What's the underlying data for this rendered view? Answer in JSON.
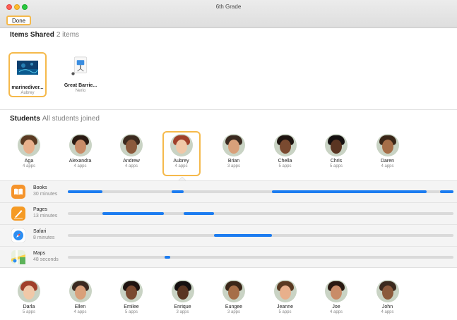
{
  "window": {
    "title": "6th Grade",
    "done_label": "Done"
  },
  "items_shared": {
    "heading": "Items Shared",
    "count": "2 items",
    "items": [
      {
        "title": "marinediver...",
        "owner": "Aubrey",
        "icon": "image-thumbnail-icon"
      },
      {
        "title": "Great Barrie...",
        "owner": "Nerio",
        "icon": "keynote-file-icon"
      }
    ]
  },
  "students": {
    "heading": "Students",
    "status": "All students joined",
    "row1": [
      {
        "name": "Aga",
        "apps": "4 apps"
      },
      {
        "name": "Alexandra",
        "apps": "4 apps"
      },
      {
        "name": "Andrew",
        "apps": "4 apps"
      },
      {
        "name": "Aubrey",
        "apps": "4 apps"
      },
      {
        "name": "Brian",
        "apps": "3 apps"
      },
      {
        "name": "Chella",
        "apps": "5 apps"
      },
      {
        "name": "Chris",
        "apps": "5 apps"
      },
      {
        "name": "Daren",
        "apps": "4 apps"
      }
    ],
    "row2": [
      {
        "name": "Darla",
        "apps": "5 apps"
      },
      {
        "name": "Ellen",
        "apps": "4 apps"
      },
      {
        "name": "Emilee",
        "apps": "5 apps"
      },
      {
        "name": "Enrique",
        "apps": "3 apps"
      },
      {
        "name": "Eungee",
        "apps": "3 apps"
      },
      {
        "name": "Jeanne",
        "apps": "5 apps"
      },
      {
        "name": "Joe",
        "apps": "4 apps"
      },
      {
        "name": "John",
        "apps": "4 apps"
      }
    ]
  },
  "app_usage": [
    {
      "name": "Books",
      "duration": "30 minutes",
      "icon": "books-icon",
      "color": "#f5942c",
      "segments": [
        [
          0.0,
          0.09
        ],
        [
          0.27,
          0.3
        ],
        [
          0.53,
          0.93
        ],
        [
          0.965,
          1.0
        ]
      ]
    },
    {
      "name": "Pages",
      "duration": "13 minutes",
      "icon": "pages-icon",
      "color": "#f59a24",
      "segments": [
        [
          0.09,
          0.25
        ],
        [
          0.3,
          0.38
        ]
      ]
    },
    {
      "name": "Safari",
      "duration": "8 minutes",
      "icon": "safari-icon",
      "color": "#2d8ef2",
      "segments": [
        [
          0.38,
          0.53
        ]
      ]
    },
    {
      "name": "Maps",
      "duration": "48 seconds",
      "icon": "maps-icon",
      "color": "#5db35a",
      "segments": [
        [
          0.25,
          0.265
        ]
      ]
    }
  ]
}
